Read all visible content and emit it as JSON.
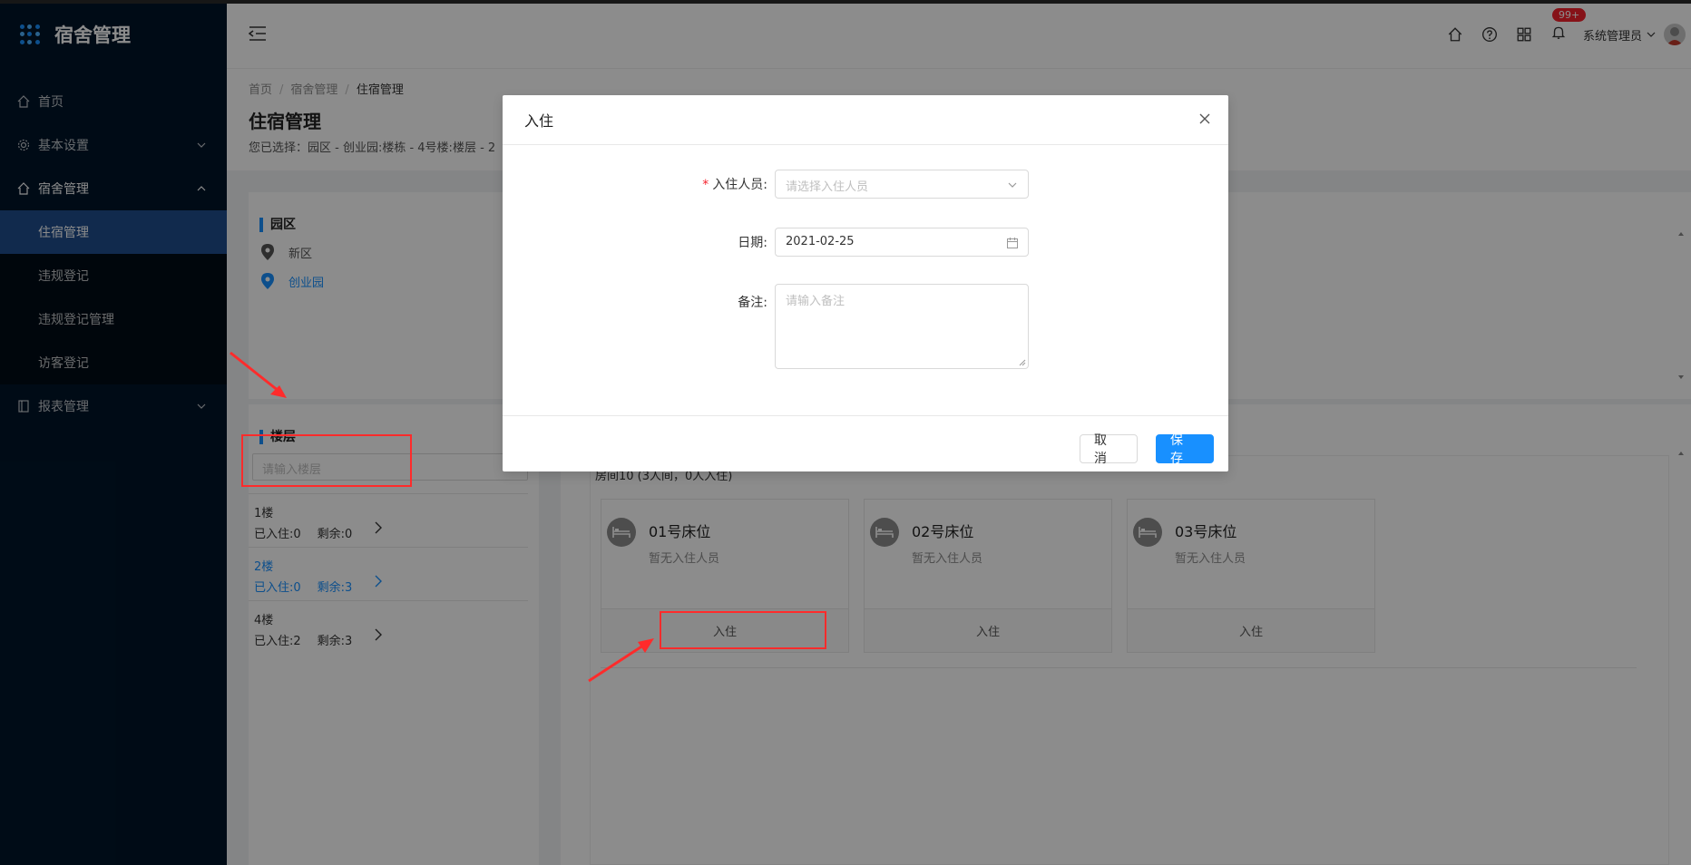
{
  "app": {
    "title": "宿舍管理"
  },
  "sidebar": {
    "items": [
      {
        "label": "首页",
        "icon": "home-icon"
      },
      {
        "label": "基本设置",
        "icon": "gear-icon"
      },
      {
        "label": "宿舍管理",
        "icon": "home-icon"
      },
      {
        "label": "报表管理",
        "icon": "book-icon"
      }
    ],
    "sub_items": [
      {
        "label": "住宿管理"
      },
      {
        "label": "违规登记"
      },
      {
        "label": "违规登记管理"
      },
      {
        "label": "访客登记"
      }
    ]
  },
  "header": {
    "badge": "99+",
    "user": "系统管理员"
  },
  "breadcrumb": [
    "首页",
    "宿舍管理",
    "住宿管理"
  ],
  "page": {
    "title": "住宿管理",
    "subtitle": "您已选择：园区 - 创业园:楼栋 - 4号楼:楼层 - 2"
  },
  "park": {
    "title": "园区",
    "items": [
      "新区",
      "创业园"
    ]
  },
  "floor": {
    "title": "楼层",
    "placeholder": "请输入楼层",
    "items": [
      {
        "name": "1楼",
        "checked_in": "已入住:0",
        "remaining": "剩余:0"
      },
      {
        "name": "2楼",
        "checked_in": "已入住:0",
        "remaining": "剩余:3"
      },
      {
        "name": "4楼",
        "checked_in": "已入住:2",
        "remaining": "剩余:3"
      }
    ]
  },
  "room": {
    "title": "房间10 (3人间，0人入住)",
    "beds": [
      {
        "name": "01号床位",
        "status": "暂无入住人员",
        "action": "入住"
      },
      {
        "name": "02号床位",
        "status": "暂无入住人员",
        "action": "入住"
      },
      {
        "name": "03号床位",
        "status": "暂无入住人员",
        "action": "入住"
      }
    ]
  },
  "modal": {
    "title": "入住",
    "person_label": "入住人员:",
    "person_placeholder": "请选择入住人员",
    "date_label": "日期:",
    "date_value": "2021-02-25",
    "note_label": "备注:",
    "note_placeholder": "请输入备注",
    "cancel": "取 消",
    "save": "保 存"
  },
  "colors": {
    "primary": "#1890ff",
    "sidebar_bg": "#001529",
    "annotation": "#ff2b2b"
  }
}
